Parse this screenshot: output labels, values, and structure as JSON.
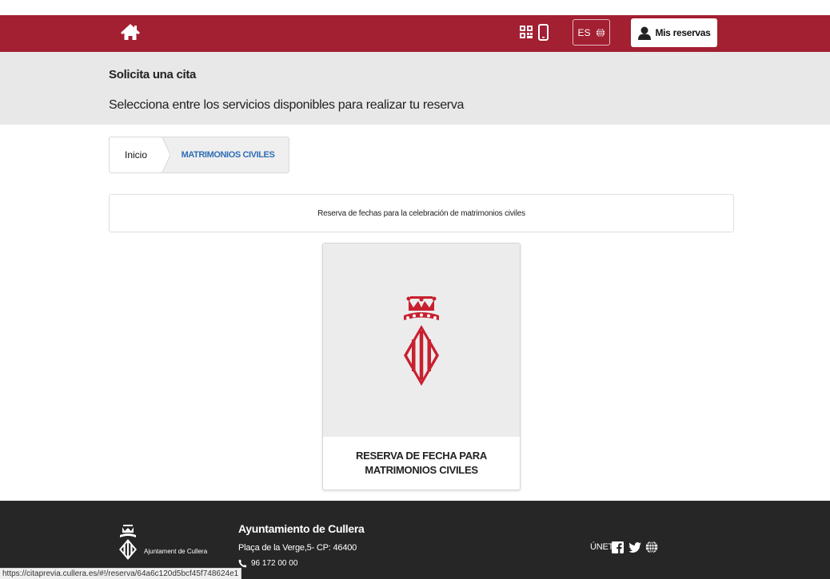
{
  "colors": {
    "header_bg": "#a31f32",
    "title_band_bg": "#e8e8e8",
    "breadcrumb_active": "#2f6eb5",
    "footer_bg": "#262626",
    "logo_red": "#c8202f"
  },
  "header": {
    "home_icon": "home-icon",
    "qr_icon": "qr-code-icon",
    "phone_icon": "mobile-phone-icon",
    "language": "ES",
    "language_icon": "globe-icon",
    "reservas_icon": "user-icon",
    "reservas_label": "Mis reservas"
  },
  "page": {
    "title": "Solicita una cita",
    "subtitle": "Selecciona entre los servicios disponibles para realizar tu reserva"
  },
  "breadcrumb": {
    "home": "Inicio",
    "current": "MATRIMONIOS CIVILES"
  },
  "info": {
    "text": "Reserva de fechas para la celebración de matrimonios civiles"
  },
  "card": {
    "logo_icon": "cullera-coat-of-arms-icon",
    "title_line1": "RESERVA DE FECHA PARA",
    "title_line2": "MATRIMONIOS CIVILES"
  },
  "footer": {
    "logo_text": "Ajuntament de Cullera",
    "org_name": "Ayuntamiento de Cullera",
    "address": "Plaça de la Verge,5- CP: 46400",
    "phone": "96 172 00 00",
    "join_label": "ÚNETE",
    "social_icons": [
      "facebook-icon",
      "twitter-icon",
      "globe-icon"
    ]
  },
  "status_bar": {
    "url": "https://citaprevia.cullera.es/#!/reserva/64a6c120d5bcf45f748624e1"
  }
}
